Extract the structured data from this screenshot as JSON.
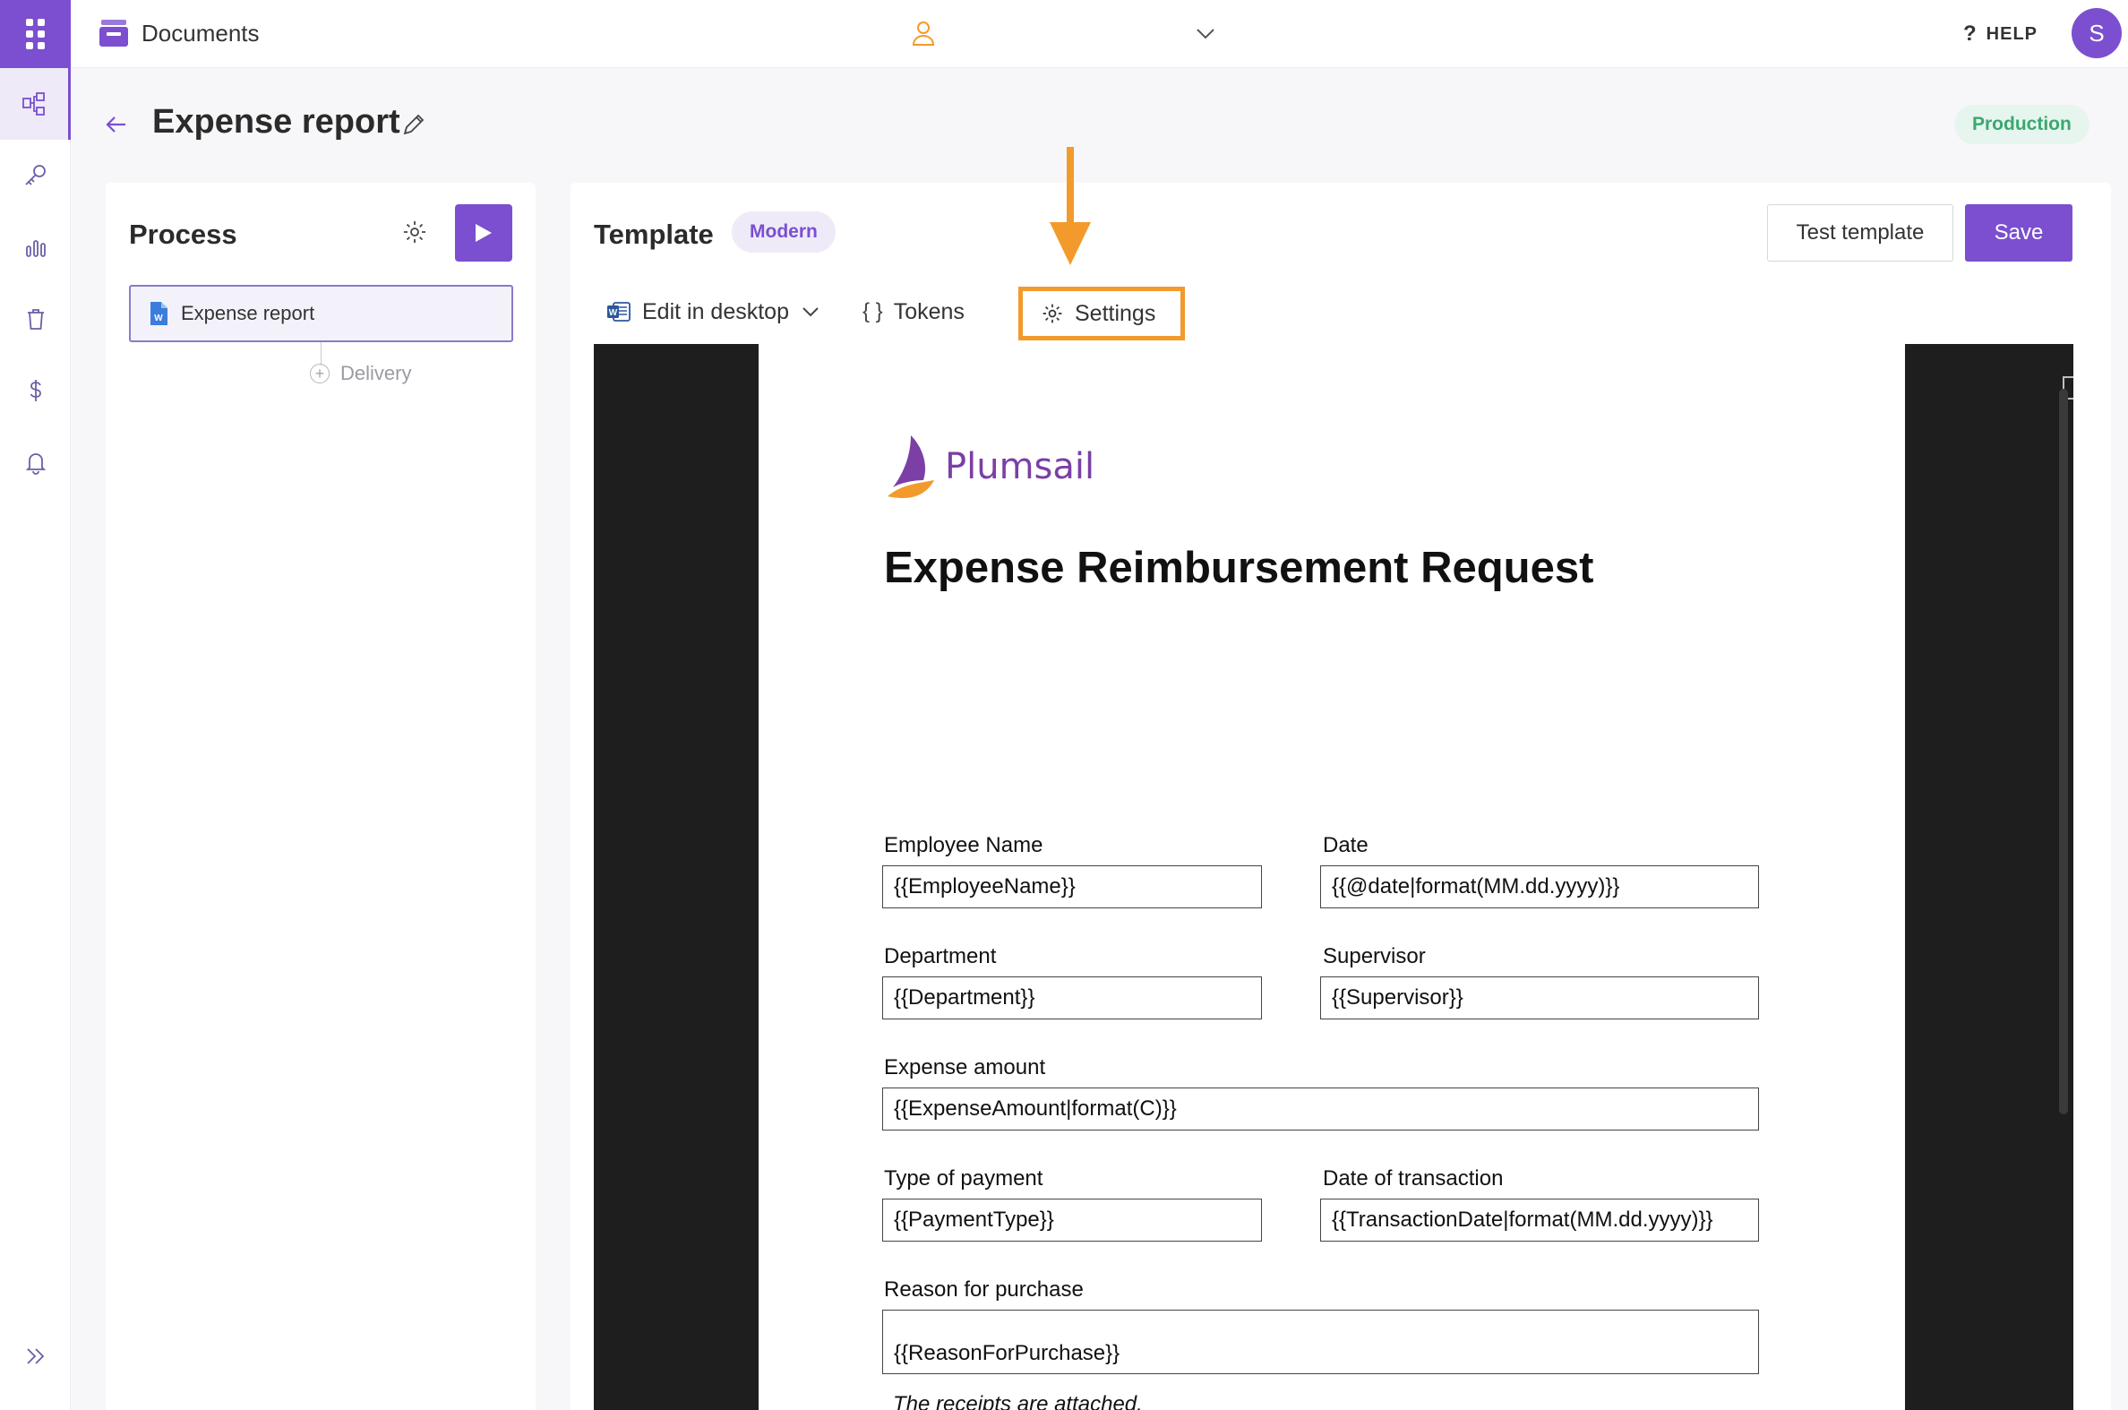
{
  "topbar": {
    "app_name": "Documents",
    "help_label": "HELP",
    "avatar_initial": "S"
  },
  "rail": {
    "items": [
      "apps-icon",
      "processes-icon",
      "key-icon",
      "reports-icon",
      "trash-icon",
      "billing-icon",
      "notifications-icon",
      "expand-icon"
    ]
  },
  "page": {
    "title": "Expense report",
    "environment_badge": "Production"
  },
  "process": {
    "title": "Process",
    "steps": [
      {
        "label": "Expense report"
      }
    ],
    "add_step_label": "Delivery"
  },
  "template": {
    "title": "Template",
    "badge": "Modern",
    "test_label": "Test template",
    "save_label": "Save",
    "toolbar": {
      "edit_label": "Edit in desktop",
      "tokens_label": "Tokens",
      "settings_label": "Settings"
    }
  },
  "document": {
    "brand": "Plumsail",
    "heading": "Expense Reimbursement Request",
    "fields": {
      "employee_name": {
        "label": "Employee Name",
        "value": "{{EmployeeName}}"
      },
      "date": {
        "label": "Date",
        "value": "{{@date|format(MM.dd.yyyy)}}"
      },
      "department": {
        "label": "Department",
        "value": "{{Department}}"
      },
      "supervisor": {
        "label": "Supervisor",
        "value": "{{Supervisor}}"
      },
      "expense_amount": {
        "label": "Expense amount",
        "value": "{{ExpenseAmount|format(C)}}"
      },
      "payment_type": {
        "label": "Type of payment",
        "value": "{{PaymentType}}"
      },
      "transaction_date": {
        "label": "Date of transaction",
        "value": "{{TransactionDate|format(MM.dd.yyyy)}}"
      },
      "reason": {
        "label": "Reason for purchase",
        "value": "{{ReasonForPurchase}}"
      }
    },
    "note": "The receipts are attached."
  },
  "colors": {
    "accent": "#7b4fcf",
    "highlight": "#f39a2c",
    "production": "#3aa871"
  }
}
